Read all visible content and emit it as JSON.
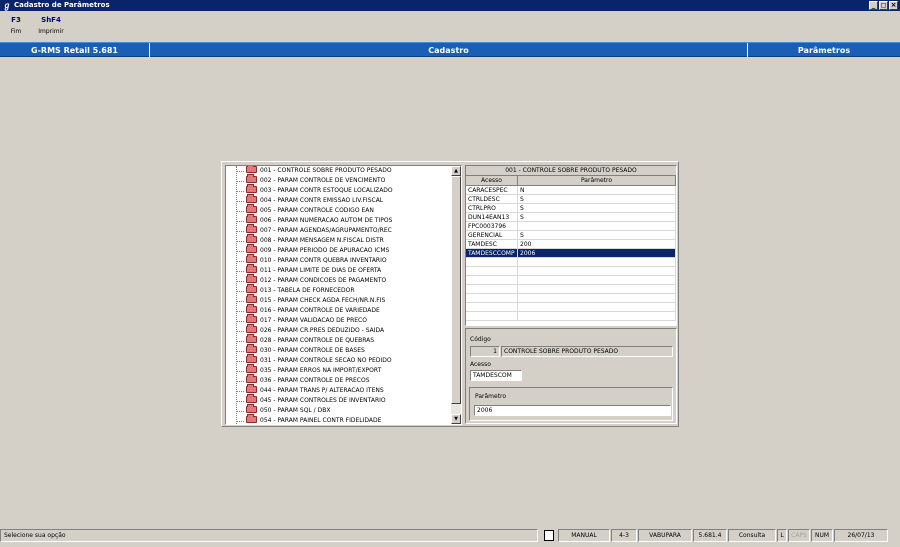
{
  "window": {
    "title": "Cadastro de Parâmetros",
    "controls": [
      "_",
      "◻",
      "×"
    ]
  },
  "toolbar": {
    "items": [
      {
        "key": "F3",
        "label": "Fim"
      },
      {
        "key": "ShF4",
        "label": "Imprimir"
      }
    ]
  },
  "header": {
    "system": "G-RMS Retail 5.681",
    "module": "Cadastro",
    "section": "Parâmetros"
  },
  "tree": {
    "items": [
      "001 - CONTROLE SOBRE PRODUTO PESADO",
      "002 - PARAM CONTROLE DE VENCIMENTO",
      "003 - PARAM CONTR ESTOQUE LOCALIZADO",
      "004 - PARAM CONTR EMISSAO LIV.FISCAL",
      "005 - PARAM CONTROLE CODIGO EAN",
      "006 - PARAM NUMERACAO AUTOM DE TIPOS",
      "007 - PARAM AGENDAS/AGRUPAMENTO/REC",
      "008 - PARAM MENSAGEM N.FISCAL DISTR",
      "009 - PARAM PERIODO DE APURACAO ICMS",
      "010 - PARAM CONTR QUEBRA INVENTARIO",
      "011 - PARAM LIMITE DE DIAS DE OFERTA",
      "012 - PARAM CONDICOES DE PAGAMENTO",
      "013 - TABELA DE FORNECEDOR",
      "015 - PARAM CHECK AGDA FECH/NR.N.FIS",
      "016 - PARAM CONTROLE DE VARIEDADE",
      "017 - PARAM VALIDACAO DE PRECO",
      "026 - PARAM CR.PRES DEDUZIDO - SAIDA",
      "028 - PARAM CONTROLE DE QUEBRAS",
      "030 - PARAM CONTROLE DE BASES",
      "031 - PARAM CONTROLE SECAO NO PEDIDO",
      "035 - PARAM ERROS NA IMPORT/EXPORT",
      "036 - PARAM CONTROLE DE PRECOS",
      "044 - PARAM TRANS P/ ALTERACAO ITENS",
      "045 - PARAM CONTROLES DE INVENTARIO",
      "050 - PARAM SQL / DBX",
      "054 - PARAM PAINEL CONTR FIDELIDADE"
    ],
    "scroll_up": "▲",
    "scroll_down": "▼"
  },
  "grid": {
    "title": "001 - CONTROLE SOBRE PRODUTO PESADO",
    "columns": [
      "Acesso",
      "Parâmetro"
    ],
    "rows": [
      {
        "acesso": "CARACESPEC",
        "parametro": "N"
      },
      {
        "acesso": "CTRLDESC",
        "parametro": "S"
      },
      {
        "acesso": "CTRLPRO",
        "parametro": "S"
      },
      {
        "acesso": "DUN14EAN13",
        "parametro": "S"
      },
      {
        "acesso": "FPC0003796",
        "parametro": ""
      },
      {
        "acesso": "GERENCIAL",
        "parametro": "S"
      },
      {
        "acesso": "TAMDESC",
        "parametro": "200"
      },
      {
        "acesso": "TAMDESCCOMP",
        "parametro": "2006"
      }
    ],
    "selected_row": 7
  },
  "form": {
    "codigo_label": "Código",
    "codigo_value": "1",
    "codigo_desc": "CONTROLE SOBRE PRODUTO PESADO",
    "acesso_label": "Acesso",
    "acesso_value": "TAMDESCOM",
    "parametro_label": "Parâmetro",
    "parametro_value": "2006"
  },
  "status": {
    "message": "Selecione sua opção",
    "mode": "MANUAL",
    "code": "4-3",
    "user": "VABUPARA",
    "version": "5.681.4",
    "action": "Consulta",
    "l": "L",
    "caps": "CAPS",
    "num": "NUM",
    "date": "26/07/13"
  }
}
